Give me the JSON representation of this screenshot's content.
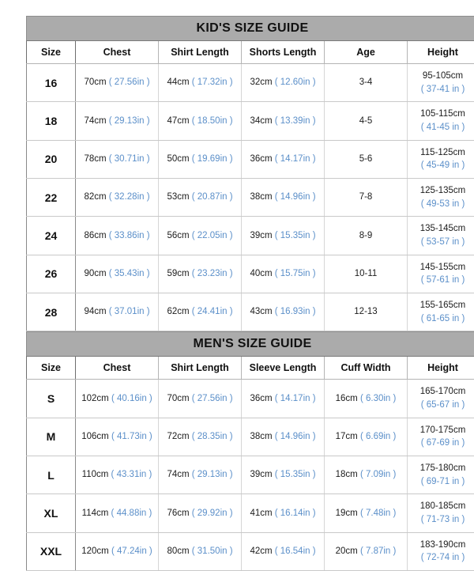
{
  "kids": {
    "title": "KID'S SIZE GUIDE",
    "headers": [
      "Size",
      "Chest",
      "Shirt Length",
      "Shorts Length",
      "Age",
      "Height"
    ],
    "rows": [
      {
        "size": "16",
        "chest_cm": "70cm",
        "chest_in": "( 27.56in )",
        "shirt_cm": "44cm",
        "shirt_in": "( 17.32in )",
        "shorts_cm": "32cm",
        "shorts_in": "( 12.60in )",
        "age": "3-4",
        "height_cm": "95-105cm",
        "height_in": "( 37-41 in )"
      },
      {
        "size": "18",
        "chest_cm": "74cm",
        "chest_in": "( 29.13in )",
        "shirt_cm": "47cm",
        "shirt_in": "( 18.50in )",
        "shorts_cm": "34cm",
        "shorts_in": "( 13.39in )",
        "age": "4-5",
        "height_cm": "105-115cm",
        "height_in": "( 41-45 in )"
      },
      {
        "size": "20",
        "chest_cm": "78cm",
        "chest_in": "( 30.71in )",
        "shirt_cm": "50cm",
        "shirt_in": "( 19.69in )",
        "shorts_cm": "36cm",
        "shorts_in": "( 14.17in )",
        "age": "5-6",
        "height_cm": "115-125cm",
        "height_in": "( 45-49 in )"
      },
      {
        "size": "22",
        "chest_cm": "82cm",
        "chest_in": "( 32.28in )",
        "shirt_cm": "53cm",
        "shirt_in": "( 20.87in )",
        "shorts_cm": "38cm",
        "shorts_in": "( 14.96in )",
        "age": "7-8",
        "height_cm": "125-135cm",
        "height_in": "( 49-53 in )"
      },
      {
        "size": "24",
        "chest_cm": "86cm",
        "chest_in": "( 33.86in )",
        "shirt_cm": "56cm",
        "shirt_in": "( 22.05in )",
        "shorts_cm": "39cm",
        "shorts_in": "( 15.35in )",
        "age": "8-9",
        "height_cm": "135-145cm",
        "height_in": "( 53-57 in )"
      },
      {
        "size": "26",
        "chest_cm": "90cm",
        "chest_in": "( 35.43in )",
        "shirt_cm": "59cm",
        "shirt_in": "( 23.23in )",
        "shorts_cm": "40cm",
        "shorts_in": "( 15.75in )",
        "age": "10-11",
        "height_cm": "145-155cm",
        "height_in": "( 57-61 in )"
      },
      {
        "size": "28",
        "chest_cm": "94cm",
        "chest_in": "( 37.01in )",
        "shirt_cm": "62cm",
        "shirt_in": "( 24.41in )",
        "shorts_cm": "43cm",
        "shorts_in": "( 16.93in )",
        "age": "12-13",
        "height_cm": "155-165cm",
        "height_in": "( 61-65 in )"
      }
    ]
  },
  "mens": {
    "title": "MEN'S SIZE GUIDE",
    "headers": [
      "Size",
      "Chest",
      "Shirt Length",
      "Sleeve Length",
      "Cuff Width",
      "Height"
    ],
    "rows": [
      {
        "size": "S",
        "chest_cm": "102cm",
        "chest_in": "( 40.16in )",
        "shirt_cm": "70cm",
        "shirt_in": "( 27.56in )",
        "sleeve_cm": "36cm",
        "sleeve_in": "( 14.17in )",
        "cuff_cm": "16cm",
        "cuff_in": "( 6.30in )",
        "height_cm": "165-170cm",
        "height_in": "( 65-67 in )"
      },
      {
        "size": "M",
        "chest_cm": "106cm",
        "chest_in": "( 41.73in )",
        "shirt_cm": "72cm",
        "shirt_in": "( 28.35in )",
        "sleeve_cm": "38cm",
        "sleeve_in": "( 14.96in )",
        "cuff_cm": "17cm",
        "cuff_in": "( 6.69in )",
        "height_cm": "170-175cm",
        "height_in": "( 67-69 in )"
      },
      {
        "size": "L",
        "chest_cm": "110cm",
        "chest_in": "( 43.31in )",
        "shirt_cm": "74cm",
        "shirt_in": "( 29.13in )",
        "sleeve_cm": "39cm",
        "sleeve_in": "( 15.35in )",
        "cuff_cm": "18cm",
        "cuff_in": "( 7.09in )",
        "height_cm": "175-180cm",
        "height_in": "( 69-71 in )"
      },
      {
        "size": "XL",
        "chest_cm": "114cm",
        "chest_in": "( 44.88in )",
        "shirt_cm": "76cm",
        "shirt_in": "( 29.92in )",
        "sleeve_cm": "41cm",
        "sleeve_in": "( 16.14in )",
        "cuff_cm": "19cm",
        "cuff_in": "( 7.48in )",
        "height_cm": "180-185cm",
        "height_in": "( 71-73 in )"
      },
      {
        "size": "XXL",
        "chest_cm": "120cm",
        "chest_in": "( 47.24in )",
        "shirt_cm": "80cm",
        "shirt_in": "( 31.50in )",
        "sleeve_cm": "42cm",
        "sleeve_in": "( 16.54in )",
        "cuff_cm": "20cm",
        "cuff_in": "( 7.87in )",
        "height_cm": "183-190cm",
        "height_in": "( 72-74 in )"
      }
    ]
  },
  "colors": {
    "title_bar_bg": "#ababab",
    "inch_text": "#5b8fc9",
    "body_text": "#1c1c1c",
    "grid_line": "#c9c9c9"
  }
}
